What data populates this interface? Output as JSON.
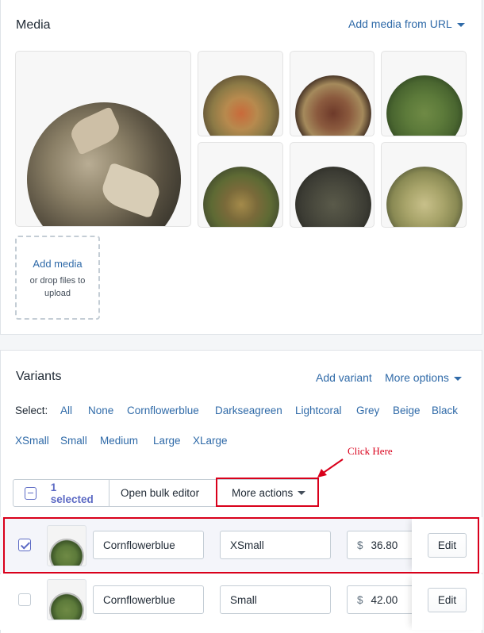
{
  "media": {
    "title": "Media",
    "add_from_url": "Add media from URL",
    "images": [
      {
        "icon": "tea-leaves-large-image"
      },
      {
        "icon": "tea-red-blend-image"
      },
      {
        "icon": "tea-berry-blend-image"
      },
      {
        "icon": "tea-green-needle-image"
      },
      {
        "icon": "tea-genmaicha-image"
      },
      {
        "icon": "tea-gunpowder-image"
      },
      {
        "icon": "tea-lemongrass-image"
      }
    ],
    "add_media_label": "Add media",
    "drop_hint": "or drop files to upload"
  },
  "variants": {
    "title": "Variants",
    "add_variant": "Add variant",
    "more_options": "More options",
    "select_label": "Select:",
    "select_options": [
      "All",
      "None",
      "Cornflowerblue",
      "Darkseagreen",
      "Lightcoral",
      "Grey",
      "Beige",
      "Black",
      "XSmall",
      "Small",
      "Medium",
      "Large",
      "XLarge"
    ],
    "bulk": {
      "selected": "1 selected",
      "open_bulk_editor": "Open bulk editor",
      "more_actions": "More actions"
    },
    "annotation": "Click Here",
    "rows": [
      {
        "color": "Cornflowerblue",
        "size": "XSmall",
        "currency": "$",
        "price": "36.80",
        "edit": "Edit",
        "checked": true
      },
      {
        "color": "Cornflowerblue",
        "size": "Small",
        "currency": "$",
        "price": "42.00",
        "edit": "Edit",
        "checked": false
      }
    ]
  },
  "colors": {
    "link": "#2f6aa8",
    "accent": "#5c6ac4",
    "annotation": "#d9001b"
  }
}
